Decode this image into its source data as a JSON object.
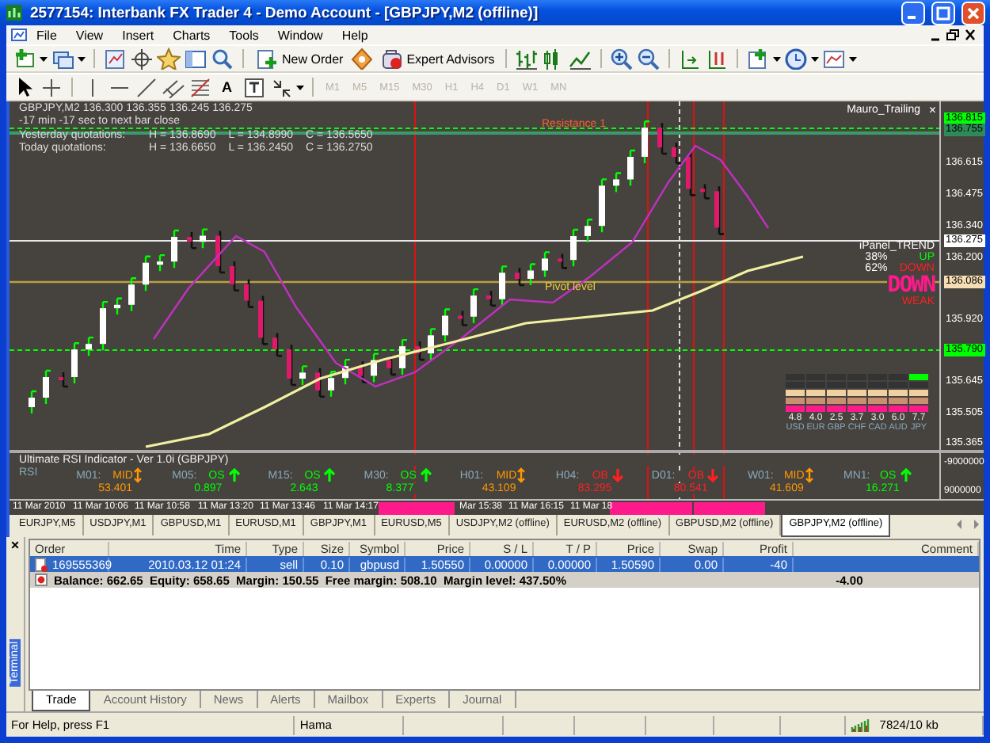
{
  "window": {
    "title": "2577154: Interbank FX Trader 4 - Demo Account - [GBPJPY,M2 (offline)]"
  },
  "menu": [
    "File",
    "View",
    "Insert",
    "Charts",
    "Tools",
    "Window",
    "Help"
  ],
  "toolbar": {
    "new_order": "New Order",
    "expert_advisors": "Expert Advisors",
    "text_tool": "A",
    "timeframes": [
      {
        "label": "M1",
        "disabled": true
      },
      {
        "label": "M5",
        "disabled": true
      },
      {
        "label": "M15",
        "disabled": true
      },
      {
        "label": "M30",
        "disabled": true
      },
      {
        "label": "H1",
        "disabled": true
      },
      {
        "label": "H4",
        "disabled": true
      },
      {
        "label": "D1",
        "disabled": true
      },
      {
        "label": "W1",
        "disabled": true
      },
      {
        "label": "MN",
        "disabled": true
      }
    ]
  },
  "chart": {
    "header": "GBPJPY,M2  136.300 136.355 136.245 136.275",
    "countdown": "-17 min -17 sec to next bar close",
    "quotations": [
      {
        "label": "Yesterday quotations:",
        "high": "H = 136.8690",
        "low": "L = 134.8990",
        "close": "C = 136.5650"
      },
      {
        "label": "Today quotations:",
        "high": "H = 136.6650",
        "low": "L = 136.2450",
        "close": "C = 136.2750"
      }
    ],
    "levels": [
      {
        "label": "Resistance 1",
        "kind": "resistance"
      },
      {
        "label": "Pivot level",
        "kind": "pivot"
      }
    ],
    "expert": {
      "name": "Mauro_Trailing",
      "close": "×"
    },
    "price_axis": [
      {
        "text": "136.815",
        "kind": "marker",
        "color": "#00ff00"
      },
      {
        "text": "136.755",
        "kind": "marker",
        "color": "#2e8b57"
      },
      {
        "text": "136.615",
        "kind": "tick"
      },
      {
        "text": "136.475",
        "kind": "tick"
      },
      {
        "text": "136.340",
        "kind": "tick"
      },
      {
        "text": "136.275",
        "kind": "marker",
        "color": "#ffffff"
      },
      {
        "text": "136.200",
        "kind": "tick"
      },
      {
        "text": "136.086",
        "kind": "marker",
        "color": "#f5deb3"
      },
      {
        "text": "135.920",
        "kind": "tick"
      },
      {
        "text": "135.790",
        "kind": "marker",
        "color": "#00ff00"
      },
      {
        "text": "135.645",
        "kind": "tick"
      },
      {
        "text": "135.505",
        "kind": "tick"
      },
      {
        "text": "135.365",
        "kind": "tick"
      }
    ],
    "trend_panel": {
      "title": "iPanel_TREND",
      "up_share": "38%",
      "up_label": "UP",
      "down_share": "62%",
      "down_label": "DOWN",
      "signal": "DOWN",
      "strength": "WEAK"
    },
    "strength_panel": [
      {
        "code": "USD",
        "value": "4.8"
      },
      {
        "code": "EUR",
        "value": "4.0"
      },
      {
        "code": "GBP",
        "value": "2.5"
      },
      {
        "code": "CHF",
        "value": "3.7"
      },
      {
        "code": "CAD",
        "value": "3.0"
      },
      {
        "code": "AUD",
        "value": "6.0"
      },
      {
        "code": "JPY",
        "value": "7.7"
      }
    ],
    "rsi": {
      "title": "Ultimate RSI Indicator - Ver 1.0i (GBPJPY)",
      "label": "RSI",
      "frames": [
        {
          "label": "M01:",
          "signal": "MID",
          "kind": "mid",
          "value": "53.401"
        },
        {
          "label": "M05:",
          "signal": "OS",
          "kind": "oversold",
          "value": "0.897"
        },
        {
          "label": "M15:",
          "signal": "OS",
          "kind": "oversold",
          "value": "2.643"
        },
        {
          "label": "M30:",
          "signal": "OS",
          "kind": "oversold",
          "value": "8.377"
        },
        {
          "label": "H01:",
          "signal": "MID",
          "kind": "mid",
          "value": "43.109"
        },
        {
          "label": "H04:",
          "signal": "OB",
          "kind": "overbought",
          "value": "83.295"
        },
        {
          "label": "D01:",
          "signal": "OB",
          "kind": "overbought",
          "value": "80.541"
        },
        {
          "label": "W01:",
          "signal": "MID",
          "kind": "mid",
          "value": "41.609"
        },
        {
          "label": "MN1:",
          "signal": "OS",
          "kind": "oversold",
          "value": "16.271"
        }
      ]
    },
    "rsi_axis": [
      "-9000000",
      "9000000"
    ],
    "time_axis": [
      "11 Mar 2010",
      "11 Mar 10:06",
      "11 Mar 10:58",
      "11 Mar 13:20",
      "11 Mar 13:46",
      "11 Mar 14:17",
      "Mar 15:38",
      "11 Mar 16:15",
      "11 Mar 18"
    ]
  },
  "chart_tabs": [
    {
      "label": "EURJPY,M5",
      "selected": false
    },
    {
      "label": "USDJPY,M1",
      "selected": false
    },
    {
      "label": "GBPUSD,M1",
      "selected": false
    },
    {
      "label": "EURUSD,M1",
      "selected": false
    },
    {
      "label": "GBPJPY,M1",
      "selected": false
    },
    {
      "label": "EURUSD,M5",
      "selected": false
    },
    {
      "label": "USDJPY,M2 (offline)",
      "selected": false
    },
    {
      "label": "EURUSD,M2 (offline)",
      "selected": false
    },
    {
      "label": "GBPUSD,M2 (offline)",
      "selected": false
    },
    {
      "label": "GBPJPY,M2 (offline)",
      "selected": true
    }
  ],
  "terminal": {
    "title": "Terminal",
    "close": "×",
    "columns": [
      "Order",
      "Time",
      "Type",
      "Size",
      "Symbol",
      "Price",
      "S / L",
      "T / P",
      "Price",
      "Swap",
      "Profit",
      "Comment"
    ],
    "rows": [
      {
        "selected": true,
        "cells": [
          "169555369",
          "2010.03.12 01:24",
          "sell",
          "0.10",
          "gbpusd",
          "1.50550",
          "0.00000",
          "0.00000",
          "1.50590",
          "0.00",
          "-40"
        ]
      }
    ],
    "balance": {
      "text": "Balance: 662.65  Equity: 658.65  Margin: 150.55  Free margin: 508.10  Margin level: 437.50%",
      "profit": "-4.00"
    },
    "tabs": [
      {
        "label": "Trade",
        "selected": true
      },
      {
        "label": "Account History",
        "selected": false
      },
      {
        "label": "News",
        "selected": false
      },
      {
        "label": "Alerts",
        "selected": false
      },
      {
        "label": "Mailbox",
        "selected": false
      },
      {
        "label": "Experts",
        "selected": false
      },
      {
        "label": "Journal",
        "selected": false
      }
    ]
  },
  "status_bar": {
    "help": "For Help, press F1",
    "profile": "Hama",
    "traffic": "7824/10 kb"
  }
}
